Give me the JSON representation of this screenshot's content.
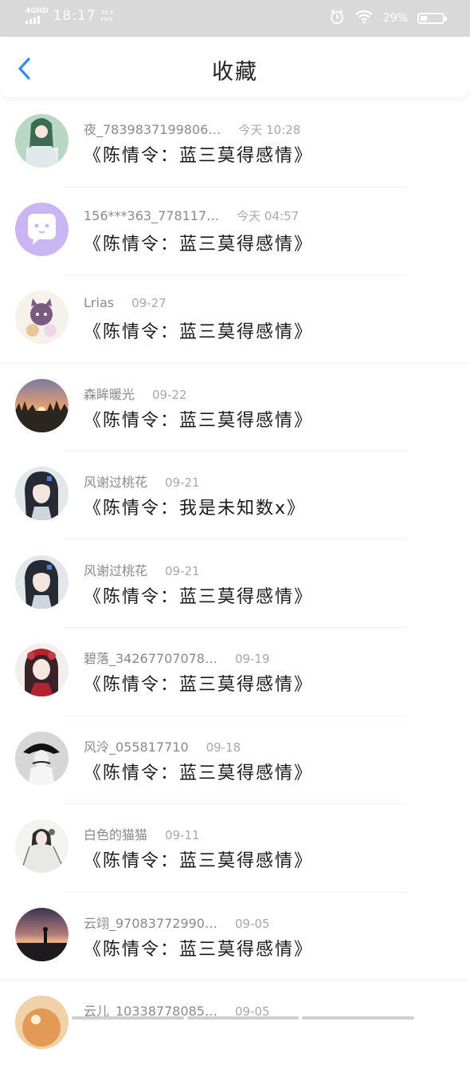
{
  "status_bar": {
    "network": "4GHD",
    "time": "18:17",
    "speed": "20.8 kb/s",
    "battery_pct": "29%",
    "battery_level": 0.29
  },
  "header": {
    "title": "收藏"
  },
  "items": [
    {
      "name": "夜_7839837199806…",
      "time": "今天 10:28",
      "text": "《陈情令：蓝三莫得感情》",
      "avatar": "anime-girl-green"
    },
    {
      "name": "156***363_778117…",
      "time": "今天 04:57",
      "text": "《陈情令：蓝三莫得感情》",
      "avatar": "default-purple-face"
    },
    {
      "name": "Lrias",
      "time": "09-27",
      "text": "《陈情令：蓝三莫得感情》",
      "avatar": "cartoon-cats"
    },
    {
      "name": "森眸暖光",
      "time": "09-22",
      "text": "《陈情令：蓝三莫得感情》",
      "avatar": "sunset-forest"
    },
    {
      "name": "风谢过桃花",
      "time": "09-21",
      "text": "《陈情令：我是未知数x》",
      "avatar": "anime-man-dark-hair"
    },
    {
      "name": "风谢过桃花",
      "time": "09-21",
      "text": "《陈情令：蓝三莫得感情》",
      "avatar": "anime-man-dark-hair"
    },
    {
      "name": "碧落_34267707078…",
      "time": "09-19",
      "text": "《陈情令：蓝三莫得感情》",
      "avatar": "anime-girl-red"
    },
    {
      "name": "风泠_055817710",
      "time": "09-18",
      "text": "《陈情令：蓝三莫得感情》",
      "avatar": "person-black-hat"
    },
    {
      "name": "白色的猫猫",
      "time": "09-11",
      "text": "《陈情令：蓝三莫得感情》",
      "avatar": "ancient-costume-figure"
    },
    {
      "name": "云翊_97083772990…",
      "time": "09-05",
      "text": "《陈情令：蓝三莫得感情》",
      "avatar": "sunset-silhouette"
    },
    {
      "name": "云儿_10338778085…",
      "time": "09-05",
      "text": "",
      "avatar": "orange-partial"
    }
  ],
  "colors": {
    "accent": "#2f8ff0",
    "status_bar_bg": "#d9d9d9",
    "name_text": "#8a8a8a",
    "body_text": "#1a1a1a"
  }
}
